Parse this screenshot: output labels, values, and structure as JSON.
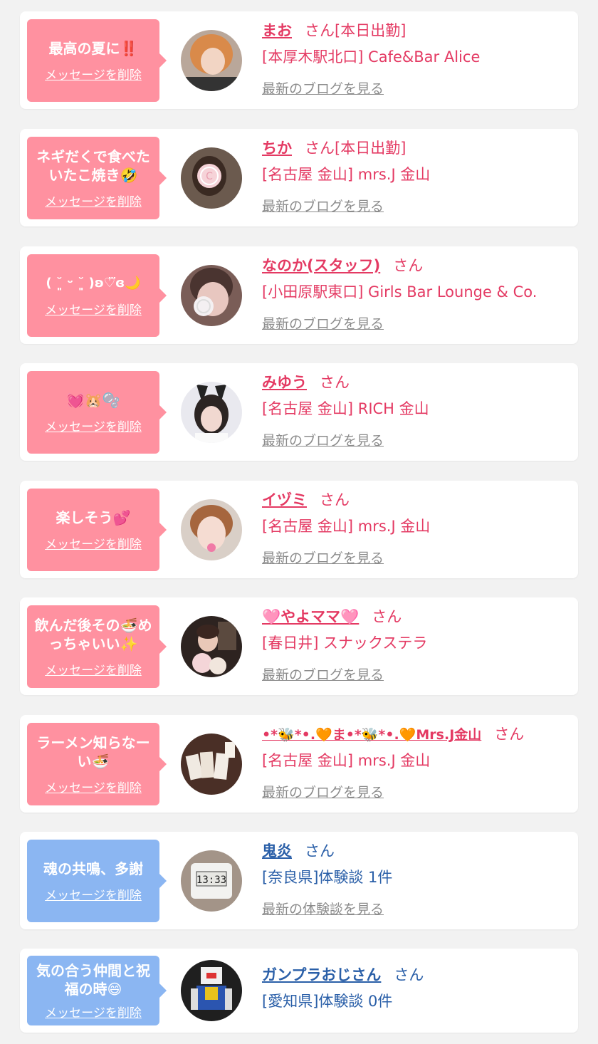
{
  "delete_label": "メッセージを削除",
  "honorific": "さん",
  "colors": {
    "pink_bubble": "#ff91a0",
    "blue_bubble": "#8bb6f2",
    "pink_text": "#e43a63",
    "blue_text": "#2a5fa8"
  },
  "items": [
    {
      "message": "最高の夏に‼️",
      "name": "まお",
      "status": "[本日出勤]",
      "shop": "[本厚木駅北口] Cafe&Bar Alice",
      "link": "最新のブログを見る",
      "theme": "pink"
    },
    {
      "message": "ネギだくで食べたいたこ焼き🤣",
      "name": "ちか",
      "status": "[本日出勤]",
      "shop": "[名古屋 金山] mrs.J 金山",
      "link": "最新のブログを見る",
      "theme": "pink"
    },
    {
      "message": "( ˘͈ ᵕ ˘͈ )ʚ♡⃛ɞ🌙",
      "name": "なのか(スタッフ)",
      "status": "",
      "shop": "[小田原駅東口] Girls Bar Lounge & Co.",
      "link": "最新のブログを見る",
      "theme": "pink"
    },
    {
      "message": "💓🐹🫧",
      "name": "みゆう",
      "status": "",
      "shop": "[名古屋 金山] RICH 金山",
      "link": "最新のブログを見る",
      "theme": "pink"
    },
    {
      "message": "楽しそう💕",
      "name": "イヅミ",
      "status": "",
      "shop": "[名古屋 金山] mrs.J 金山",
      "link": "最新のブログを見る",
      "theme": "pink"
    },
    {
      "message": "飲んだ後その🍜めっちゃいい✨",
      "name": "🩷やよママ🩷",
      "status": "",
      "shop": "[春日井] スナックステラ",
      "link": "最新のブログを見る",
      "theme": "pink"
    },
    {
      "message": "ラーメン知らなーい🍜",
      "name": "•*🐝*•.🧡ま•*🐝*•.🧡Mrs.J金山",
      "status": "",
      "shop": "[名古屋 金山] mrs.J 金山",
      "link": "最新のブログを見る",
      "theme": "pink"
    },
    {
      "message": "魂の共鳴、多謝",
      "name": "鬼炎",
      "status": "",
      "shop": "[奈良県]体験談 1件",
      "link": "最新の体験談を見る",
      "theme": "blue"
    },
    {
      "message": "気の合う仲間と祝福の時😄",
      "name": "ガンプラおじさん",
      "status": "",
      "shop": "[愛知県]体験談 0件",
      "link": "",
      "theme": "blue"
    }
  ]
}
